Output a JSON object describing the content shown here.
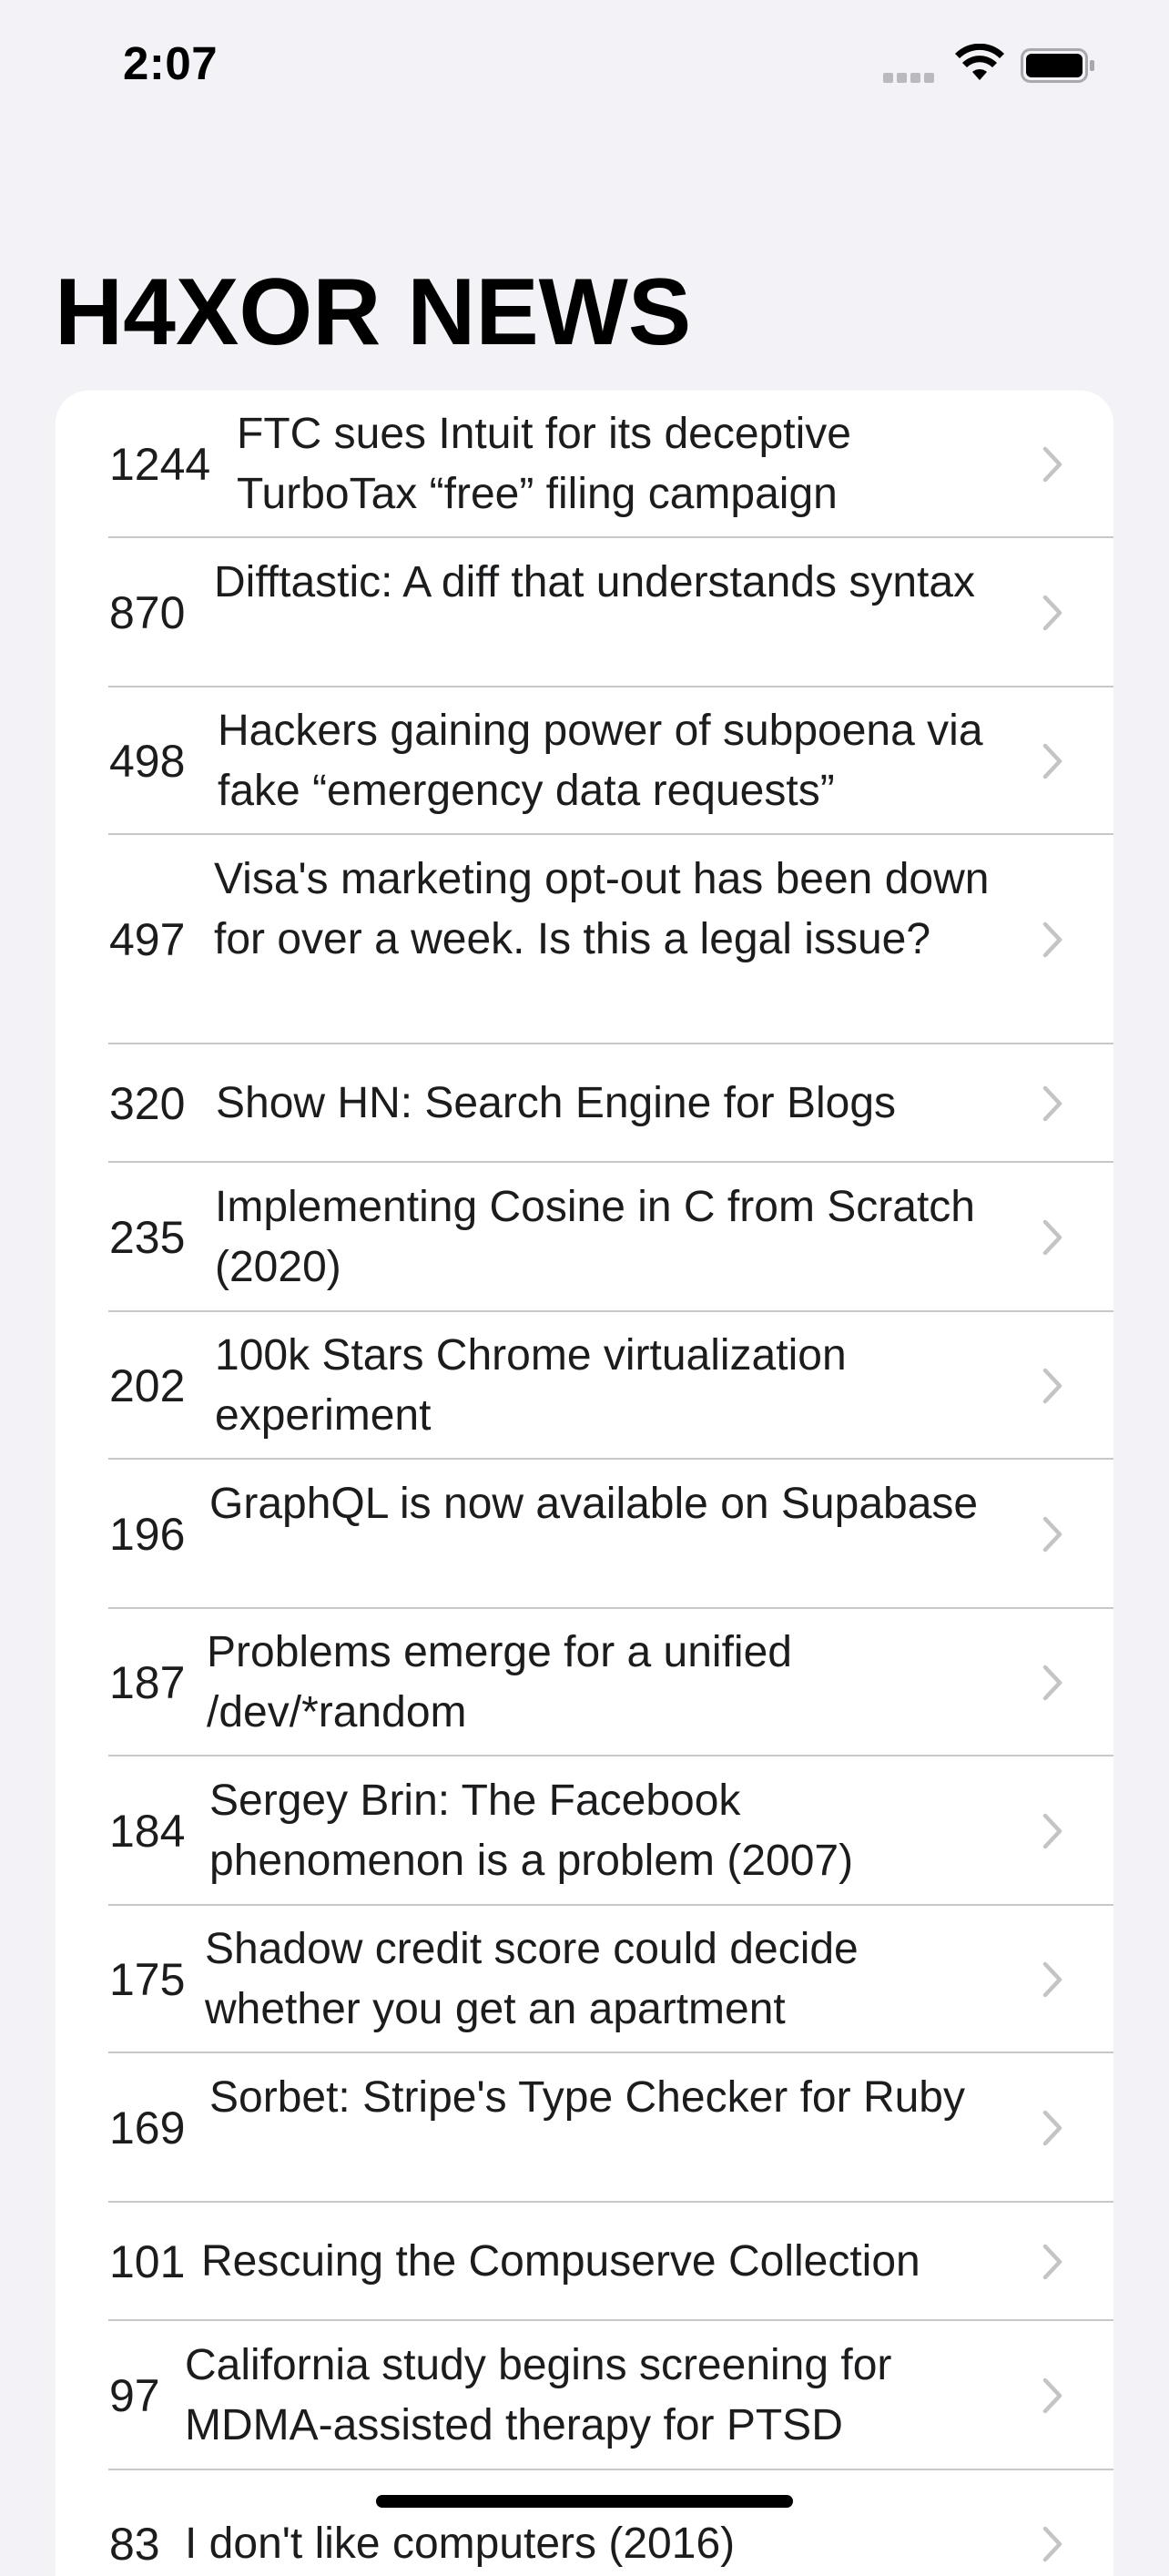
{
  "status_bar": {
    "time": "2:07"
  },
  "header": {
    "title": "H4XOR NEWS"
  },
  "colors": {
    "background": "#f2f2f7",
    "card": "#ffffff",
    "separator": "#c8c8cc",
    "chevron": "#c4c4c7"
  },
  "icons": {
    "signal": "cellular-signal-icon",
    "wifi": "wifi-icon",
    "battery": "battery-icon",
    "row_disclosure": "chevron-right-icon"
  },
  "stories": [
    {
      "score": "1244",
      "title": "FTC sues Intuit for its deceptive TurboTax “free” filing campaign"
    },
    {
      "score": "870",
      "title": "Difftastic: A diff that understands syntax"
    },
    {
      "score": "498",
      "title": "Hackers gaining power of subpoena via fake “emergency data requests”"
    },
    {
      "score": "497",
      "title": "Visa's marketing opt-out has been down for over a week. Is this a legal issue?"
    },
    {
      "score": "320",
      "title": "Show HN: Search Engine for Blogs"
    },
    {
      "score": "235",
      "title": "Implementing Cosine in C from Scratch (2020)"
    },
    {
      "score": "202",
      "title": "100k Stars Chrome virtualization experiment"
    },
    {
      "score": "196",
      "title": "GraphQL is now available on Supabase"
    },
    {
      "score": "187",
      "title": "Problems emerge for a unified /dev/*random"
    },
    {
      "score": "184",
      "title": "Sergey Brin: The Facebook phenomenon is a problem (2007)"
    },
    {
      "score": "175",
      "title": "Shadow credit score could decide whether you get an apartment"
    },
    {
      "score": "169",
      "title": "Sorbet: Stripe's Type Checker for Ruby"
    },
    {
      "score": "101",
      "title": "Rescuing the Compuserve Collection"
    },
    {
      "score": "97",
      "title": "California study begins screening for MDMA-assisted therapy for PTSD"
    },
    {
      "score": "83",
      "title": "I don't like computers (2016)"
    }
  ]
}
